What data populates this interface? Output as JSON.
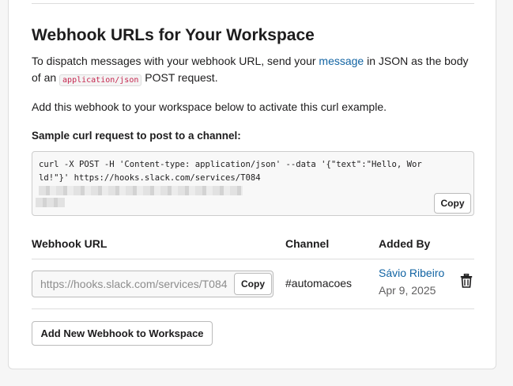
{
  "section": {
    "title": "Webhook URLs for Your Workspace",
    "desc_before_link": "To dispatch messages with your webhook URL, send your ",
    "desc_link": "message",
    "desc_after_link": " in JSON as the body of an ",
    "desc_code": "application/json",
    "desc_after_code": " POST request.",
    "instruction": "Add this webhook to your workspace below to activate this curl example."
  },
  "sample": {
    "label": "Sample curl request to post to a channel:",
    "code": "curl -X POST -H 'Content-type: application/json' --data '{\"text\":\"Hello, World!\"}' https://hooks.slack.com/services/T084",
    "copy_label": "Copy"
  },
  "table": {
    "headers": {
      "url": "Webhook URL",
      "channel": "Channel",
      "added_by": "Added By"
    },
    "rows": [
      {
        "url": "https://hooks.slack.com/services/T084",
        "copy_label": "Copy",
        "channel": "#automacoes",
        "added_by_name": "Sávio Ribeiro",
        "added_date": "Apr 9, 2025",
        "delete_icon": "trash-icon"
      }
    ]
  },
  "add_button_label": "Add New Webhook to Workspace",
  "colors": {
    "link": "#1264a3",
    "code_inline": "#c5254e",
    "border": "#dddddd"
  }
}
